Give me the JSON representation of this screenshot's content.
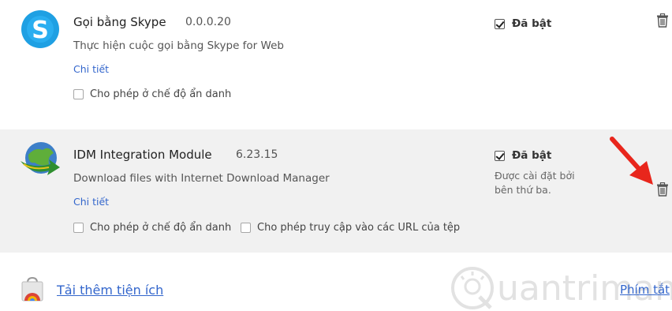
{
  "extensions": [
    {
      "name": "Gọi bằng Skype",
      "version": "0.0.0.20",
      "description": "Thực hiện cuộc gọi bằng Skype for Web",
      "details_link": "Chi tiết",
      "incognito_label": "Cho phép ở chế độ ẩn danh",
      "enabled_label": "Đã bật",
      "enabled": true,
      "icon": "skype-icon"
    },
    {
      "name": "IDM Integration Module",
      "version": "6.23.15",
      "description": "Download files with Internet Download Manager",
      "details_link": "Chi tiết",
      "incognito_label": "Cho phép ở chế độ ẩn danh",
      "file_url_label": "Cho phép truy cập vào các URL của tệp",
      "enabled_label": "Đã bật",
      "enabled": true,
      "installed_by_note": "Được cài đặt bởi bên thứ ba.",
      "icon": "idm-icon",
      "highlighted": true
    }
  ],
  "footer": {
    "get_more_label": "Tải thêm tiện ích",
    "shortcuts_label": "Phím tắt"
  },
  "colors": {
    "link": "#3366cc",
    "highlight_bg": "#f1f1f1",
    "arrow": "#e8261c"
  }
}
